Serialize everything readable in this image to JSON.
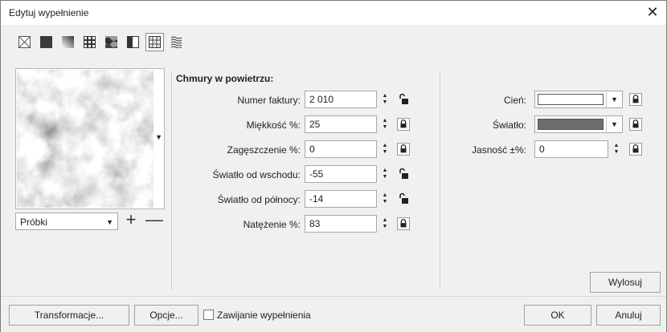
{
  "window": {
    "title": "Edytuj wypełnienie",
    "close_icon": "close-icon"
  },
  "fill_types": [
    {
      "name": "no-fill-icon",
      "active": false
    },
    {
      "name": "uniform-fill-icon",
      "active": false
    },
    {
      "name": "fountain-fill-icon",
      "active": false
    },
    {
      "name": "vector-pattern-icon",
      "active": false
    },
    {
      "name": "bitmap-pattern-icon",
      "active": false
    },
    {
      "name": "two-color-pattern-icon",
      "active": false
    },
    {
      "name": "texture-fill-icon",
      "active": true
    },
    {
      "name": "postscript-fill-icon",
      "active": false
    }
  ],
  "samples": {
    "label": "Próbki"
  },
  "texture": {
    "section_title": "Chmury w powietrzu:",
    "params": [
      {
        "label": "Numer faktury:",
        "value": "2 010",
        "locked": false
      },
      {
        "label": "Miękkość %:",
        "value": "25",
        "locked": true
      },
      {
        "label": "Zagęszczenie %:",
        "value": "0",
        "locked": true
      },
      {
        "label": "Światło od wschodu:",
        "value": "-55",
        "locked": false
      },
      {
        "label": "Światło od północy:",
        "value": "-14",
        "locked": false
      },
      {
        "label": "Natężenie %:",
        "value": "83",
        "locked": true
      }
    ]
  },
  "colors": {
    "shadow": {
      "label": "Cień:",
      "color": "#ffffff"
    },
    "light": {
      "label": "Światło:",
      "color": "#6e6e6e"
    },
    "brightness": {
      "label": "Jasność ±%:",
      "value": "0"
    }
  },
  "buttons": {
    "randomize": "Wylosuj",
    "transformations": "Transformacje...",
    "options": "Opcje...",
    "wrap_label": "Zawijanie wypełnienia",
    "ok": "OK",
    "cancel": "Anuluj"
  }
}
